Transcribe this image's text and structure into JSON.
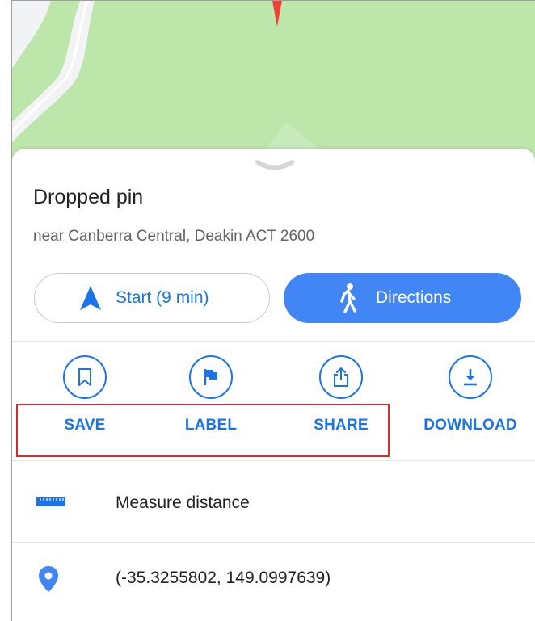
{
  "place": {
    "title": "Dropped pin",
    "address": "near Canberra Central, Deakin ACT 2600"
  },
  "buttons": {
    "start": {
      "label": "Start (9 min)",
      "icon": "navigation-arrow-icon"
    },
    "directions": {
      "label": "Directions",
      "icon": "walking-person-icon"
    }
  },
  "actions": [
    {
      "label": "SAVE",
      "icon": "bookmark-icon"
    },
    {
      "label": "LABEL",
      "icon": "flag-icon"
    },
    {
      "label": "SHARE",
      "icon": "share-icon"
    },
    {
      "label": "DOWNLOAD",
      "icon": "download-icon"
    }
  ],
  "list": {
    "measure": {
      "label": "Measure distance",
      "icon": "ruler-icon"
    },
    "coordinates": {
      "label": "(-35.3255802, 149.0997639)",
      "icon": "location-pin-icon"
    }
  },
  "colors": {
    "accent": "#1a73e8",
    "primary_button": "#4285f4",
    "map_park": "#bde6ab",
    "map_road": "#f1f3f4",
    "pin": "#ea4335",
    "highlight_box": "#d32f2f"
  }
}
